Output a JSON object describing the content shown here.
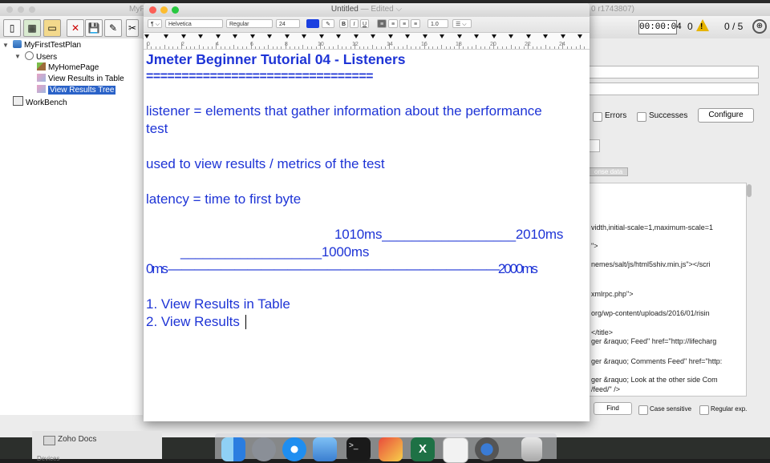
{
  "jmeter": {
    "title_left": "MyF",
    "title_right": "0 r1743807)",
    "timer": "00:00:04",
    "warning_count": "0",
    "threads": "0 / 5",
    "tree": {
      "plan": "MyFirstTestPlan",
      "users": "Users",
      "homepage": "MyHomePage",
      "table": "View Results in Table",
      "tree": "View Results Tree",
      "workbench": "WorkBench"
    },
    "panel": {
      "errors": "Errors",
      "successes": "Successes",
      "configure": "Configure",
      "tab_label": "onse data",
      "code_lines": [
        "vidth,initial-scale=1,maximum-scale=1",
        "\">",
        "nemes/salt/js/html5shiv.min.js\"></scri",
        "xmlrpc.php\">",
        "org/wp-content/uploads/2016/01/risin",
        "</title>",
        "ger &raquo; Feed\" href=\"http://lifecharg",
        "ger &raquo; Comments Feed\" href=\"http:",
        "ger &raquo; Look at the other side Com",
        "/feed/\" />"
      ],
      "find": "Find",
      "case_sensitive": "Case sensitive",
      "regular_exp": "Regular exp."
    }
  },
  "textedit": {
    "title": "Untitled",
    "edited": " — Edited ⌵",
    "format_bar": {
      "para": "¶ ⌵",
      "font": "Helvetica",
      "style": "Regular",
      "size": "24",
      "bold": "B",
      "italic": "I",
      "underline": "U",
      "spacing": "1.0",
      "list": "☰ ⌵"
    },
    "ruler_numbers": [
      "0",
      "2",
      "4",
      "6",
      "8",
      "10",
      "12",
      "14",
      "16",
      "18",
      "20",
      "22",
      "24"
    ],
    "lines": {
      "heading": "Jmeter Beginner Tutorial 04 - Listeners",
      "underline": "================================",
      "l1": "listener = elements that gather information about the performance",
      "l2": "test",
      "l3": "used to view results / metrics of the test",
      "l4": "latency = time to first byte",
      "d1": "1010ms__________________2010ms",
      "d2": "___________________1000ms",
      "d3": "0ms — — — — — — — — — — — — — — — — — — — — — — — — —2000ms",
      "i1": "1. View Results in Table",
      "i2": "2. View Results"
    }
  },
  "dock": {
    "zoho_docs": "Zoho Docs",
    "devices": "Devices"
  },
  "colors": {
    "doc_text": "#1e34d6",
    "selection": "#2a62c8",
    "close": "#fc5f57",
    "minimize": "#fdbc2e",
    "zoom": "#28c840"
  }
}
